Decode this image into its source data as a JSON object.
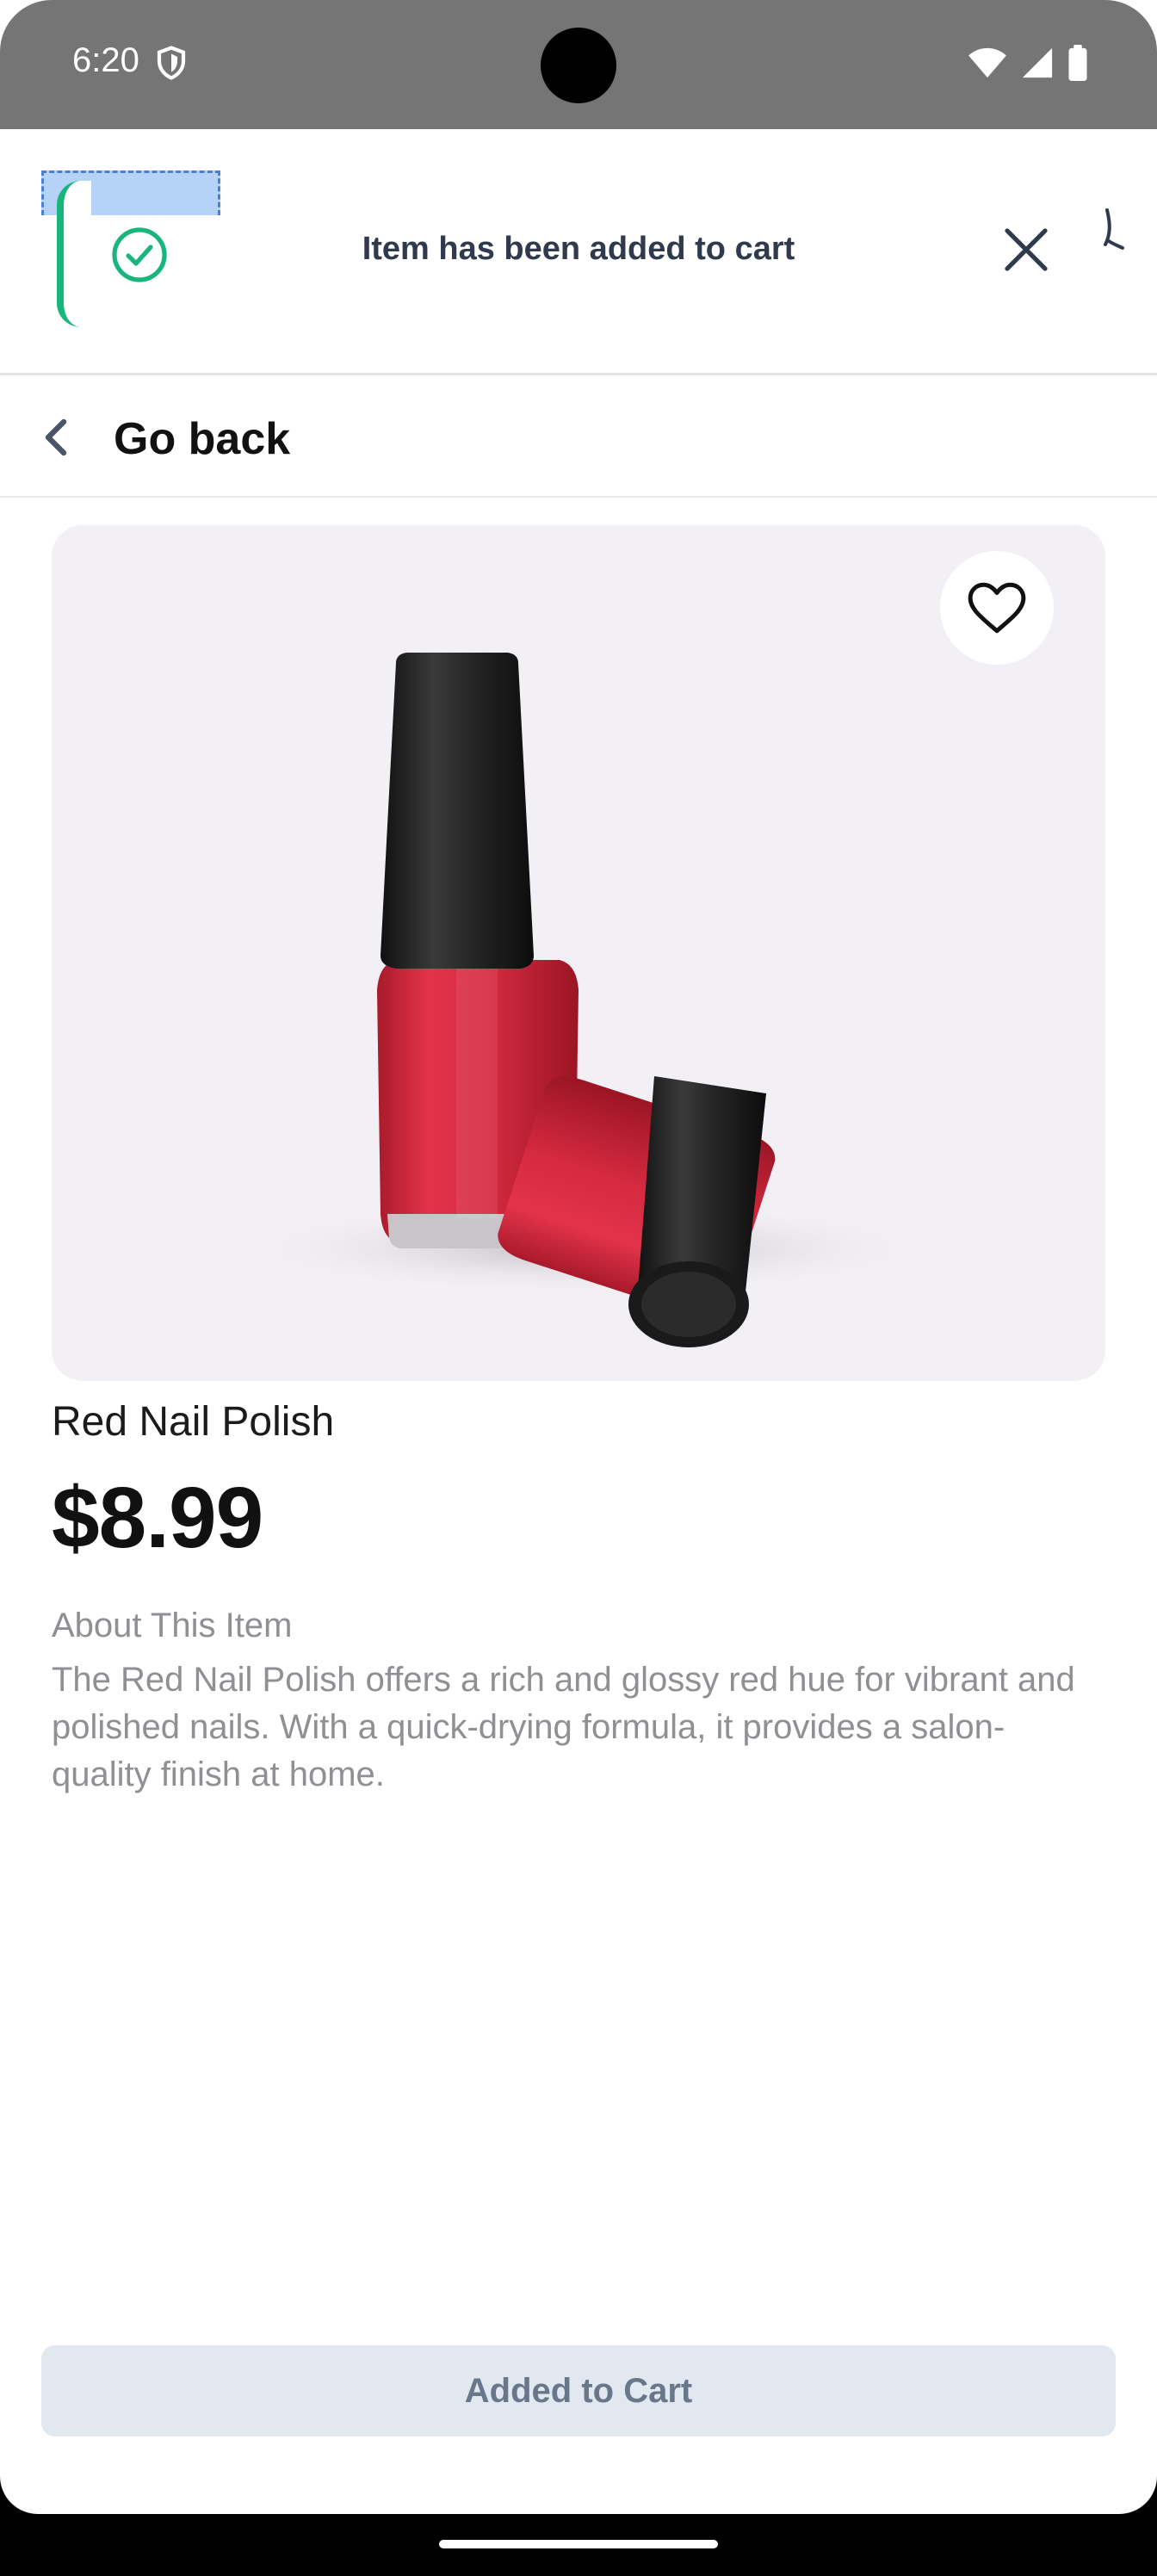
{
  "status_bar": {
    "time": "6:20"
  },
  "toast": {
    "message": "Item has been added to cart",
    "accent_color": "#18b57c"
  },
  "header": {
    "title": "Go back"
  },
  "product": {
    "name": "Red Nail Polish",
    "price": "$8.99",
    "about_title": "About This Item",
    "about_text": "The Red Nail Polish offers a rich and glossy red hue for vibrant and polished nails. With a quick-drying formula, it provides a salon-quality finish at home."
  },
  "cart_button": {
    "label": "Added to Cart",
    "state": "disabled"
  },
  "icons": [
    "shield-icon",
    "wifi-icon",
    "signal-icon",
    "battery-icon",
    "check-circle-icon",
    "close-icon",
    "chevron-left-icon",
    "heart-icon"
  ]
}
